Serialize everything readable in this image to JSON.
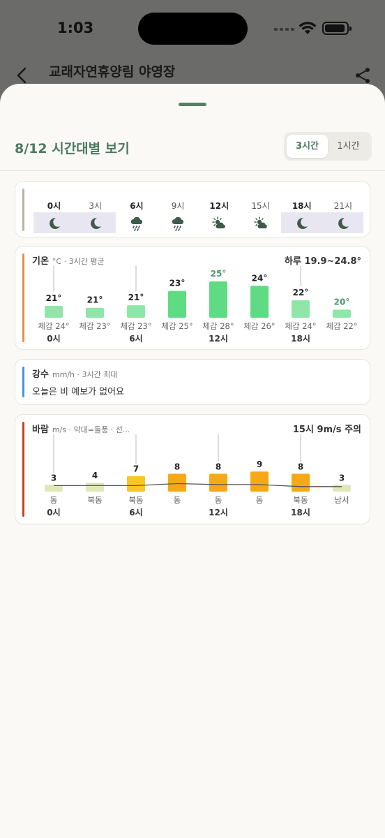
{
  "status": {
    "time": "1:03"
  },
  "background_page": {
    "title": "교래자연휴양림 야영장"
  },
  "sheet": {
    "title": "8/12 시간대별 보기",
    "segments": [
      "3시간",
      "1시간"
    ],
    "selected_segment": "3시간"
  },
  "sky": {
    "hours": [
      {
        "label": "0시",
        "bold": true,
        "night": true,
        "icon": "moon-icon"
      },
      {
        "label": "3시",
        "bold": false,
        "night": true,
        "icon": "moon-icon"
      },
      {
        "label": "6시",
        "bold": true,
        "night": false,
        "icon": "rain-cloud-icon"
      },
      {
        "label": "9시",
        "bold": false,
        "night": false,
        "icon": "rain-cloud-icon"
      },
      {
        "label": "12시",
        "bold": true,
        "night": false,
        "icon": "partly-sunny-icon"
      },
      {
        "label": "15시",
        "bold": false,
        "night": false,
        "icon": "partly-sunny-icon"
      },
      {
        "label": "18시",
        "bold": true,
        "night": true,
        "icon": "moon-icon"
      },
      {
        "label": "21시",
        "bold": false,
        "night": true,
        "icon": "moon-icon"
      }
    ],
    "accent": "#b9b2a8"
  },
  "temperature": {
    "title": "기온",
    "subtitle": "°C · 3시간 평균",
    "range": "하루 19.9~24.8°",
    "accent": "#e0914a",
    "value_labels": [
      "21°",
      "21°",
      "21°",
      "23°",
      "25°",
      "24°",
      "22°",
      "20°"
    ],
    "feels": [
      "체감 24°",
      "체감 23°",
      "체감 23°",
      "체감 25°",
      "체감 28°",
      "체감 26°",
      "체감 24°",
      "체감 22°"
    ],
    "hour_labels": [
      "0시",
      "",
      "6시",
      "",
      "12시",
      "",
      "18시",
      ""
    ]
  },
  "rain": {
    "title": "강수",
    "subtitle": "mm/h · 3시간 최대",
    "message": "오늘은 비 예보가 없어요",
    "accent": "#4a8fe0"
  },
  "wind": {
    "title": "바람",
    "subtitle": "m/s · 막대=돌풍 · 선...",
    "alert": "15시 9m/s 주의",
    "accent": "#c0461f",
    "value_labels": [
      "3",
      "4",
      "7",
      "8",
      "8",
      "9",
      "8",
      "3"
    ],
    "directions": [
      "동",
      "북동",
      "북동",
      "동",
      "동",
      "동",
      "북동",
      "남서"
    ],
    "hour_labels": [
      "0시",
      "",
      "6시",
      "",
      "12시",
      "",
      "18시",
      ""
    ]
  },
  "chart_data": [
    {
      "type": "bar",
      "title": "기온",
      "categories": [
        "0시",
        "3시",
        "6시",
        "9시",
        "12시",
        "15시",
        "18시",
        "21시"
      ],
      "values": [
        20.9,
        20.6,
        21.0,
        23.3,
        24.8,
        24.1,
        21.8,
        20.3
      ],
      "feels_like": [
        24,
        23,
        23,
        25,
        28,
        26,
        24,
        22
      ],
      "ylim": [
        19.9,
        24.8
      ]
    },
    {
      "type": "bar",
      "title": "바람",
      "categories": [
        "0시",
        "3시",
        "6시",
        "9시",
        "12시",
        "15시",
        "18시",
        "21시"
      ],
      "values": [
        3,
        4,
        7,
        8,
        8,
        9,
        8,
        3
      ],
      "line": [
        3,
        3,
        3,
        4,
        3.5,
        3.5,
        2.5,
        2.5
      ],
      "directions": [
        "동",
        "북동",
        "북동",
        "동",
        "동",
        "동",
        "북동",
        "남서"
      ]
    }
  ]
}
